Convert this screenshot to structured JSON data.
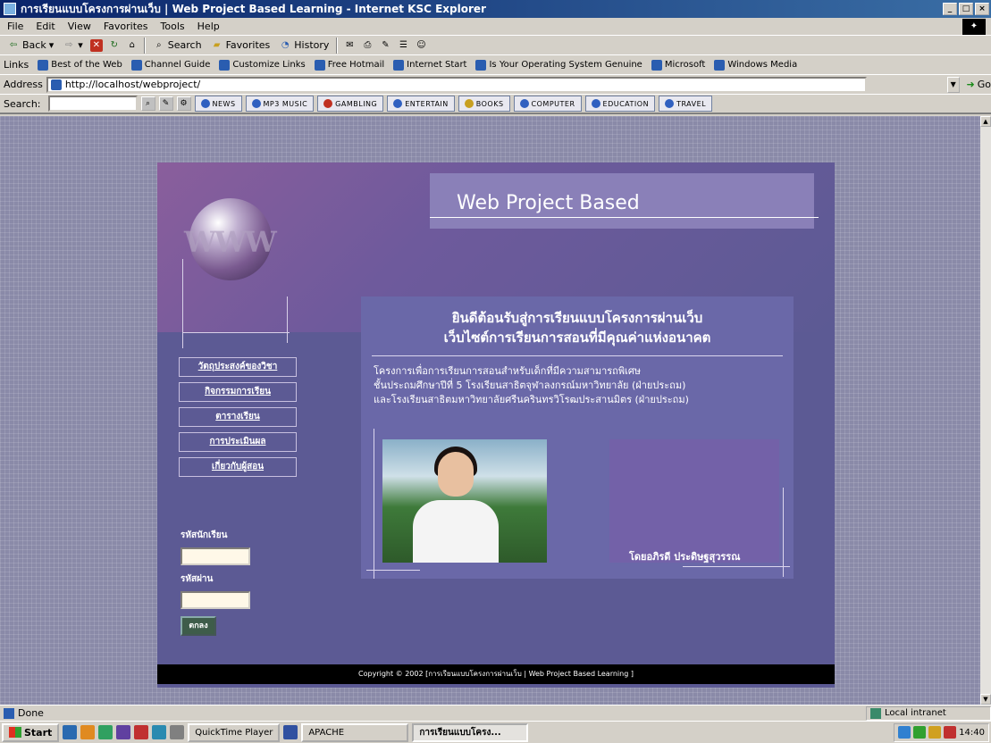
{
  "window": {
    "title": "การเรียนแบบโครงการผ่านเว็บ | Web Project Based Learning - Internet KSC Explorer",
    "minimize": "_",
    "maximize": "□",
    "close": "×"
  },
  "menu": [
    "File",
    "Edit",
    "View",
    "Favorites",
    "Tools",
    "Help"
  ],
  "toolbar": {
    "back": "Back",
    "search": "Search",
    "favorites": "Favorites",
    "history": "History"
  },
  "links": {
    "label": "Links",
    "items": [
      "Best of the Web",
      "Channel Guide",
      "Customize Links",
      "Free Hotmail",
      "Internet Start",
      "Is Your Operating System Genuine",
      "Microsoft",
      "Windows Media"
    ]
  },
  "address": {
    "label": "Address",
    "url": "http://localhost/webproject/",
    "go": "Go"
  },
  "searchbar": {
    "label": "Search:",
    "categories": [
      "NEWS",
      "MP3 MUSIC",
      "GAMBLING",
      "ENTERTAIN",
      "BOOKS",
      "COMPUTER",
      "EDUCATION",
      "TRAVEL"
    ]
  },
  "site": {
    "header_title": "Web Project Based",
    "logo_text": "WWW",
    "nav": [
      "วัตถุประสงค์ของวิชา",
      "กิจกรรมการเรียน",
      "ตารางเรียน",
      "การประเมินผล",
      "เกี่ยวกับผู้สอน"
    ],
    "login": {
      "student_id_label": "รหัสนักเรียน",
      "password_label": "รหัสผ่าน",
      "submit_label": "ตกลง"
    },
    "welcome_line1": "ยินดีต้อนรับสู่การเรียนแบบโครงการผ่านเว็บ",
    "welcome_line2": "เว็บไซต์การเรียนการสอนที่มีคุณค่าแห่งอนาคต",
    "body_line1": "โครงการเพื่อการเรียนการสอนสำหรับเด็กที่มีความสามารถพิเศษ",
    "body_line2": "ชั้นประถมศึกษาปีที่ 5 โรงเรียนสาธิตจุฬาลงกรณ์มหาวิทยาลัย (ฝ่ายประถม)",
    "body_line3": "และโรงเรียนสาธิตมหาวิทยาลัยศรีนครินทรวิโรฒประสานมิตร (ฝ่ายประถม)",
    "author": "โดยอภิรดี ประดิษฐสุวรรณ",
    "footer": "Copyright © 2002 [การเรียนแบบโครงการผ่านเว็บ | Web Project Based Learning ]"
  },
  "status": {
    "text": "Done",
    "zone": "Local intranet"
  },
  "taskbar": {
    "start": "Start",
    "tasks": [
      "QuickTime Player",
      "APACHE",
      "การเรียนแบบโครง..."
    ],
    "clock": "14:40"
  }
}
